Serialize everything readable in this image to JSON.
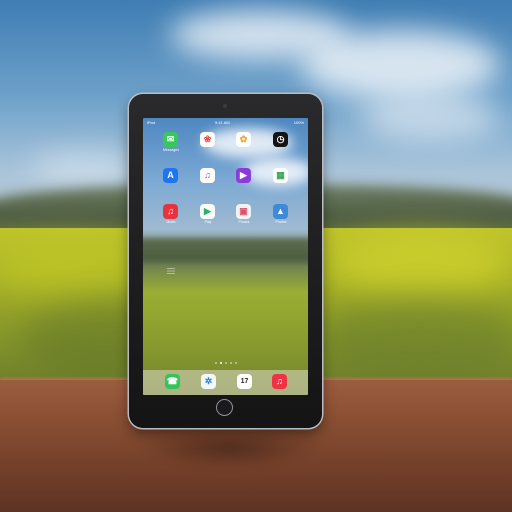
{
  "status_bar": {
    "carrier": "iPad",
    "time": "9:41 AM",
    "battery": "100%"
  },
  "home_apps": [
    {
      "name": "messages",
      "label": "Messages",
      "glyph": "✉"
    },
    {
      "name": "photos",
      "label": "",
      "glyph": "❀"
    },
    {
      "name": "photo-app",
      "label": "",
      "glyph": "✿"
    },
    {
      "name": "clock",
      "label": "",
      "glyph": "◷"
    },
    {
      "name": "app-store",
      "label": "",
      "glyph": "A"
    },
    {
      "name": "music",
      "label": "",
      "glyph": "♫"
    },
    {
      "name": "video",
      "label": "",
      "glyph": "▶"
    },
    {
      "name": "maps",
      "label": "",
      "glyph": "▦"
    },
    {
      "name": "itunes",
      "label": "Music",
      "glyph": "♫"
    },
    {
      "name": "play",
      "label": "Play",
      "glyph": "▶"
    },
    {
      "name": "grid-app",
      "label": "Photos",
      "glyph": "▣"
    },
    {
      "name": "blue-app",
      "label": "Photos",
      "glyph": "▲"
    }
  ],
  "dock_apps": [
    {
      "name": "phone",
      "glyph": "☎"
    },
    {
      "name": "safari",
      "glyph": "✲"
    },
    {
      "name": "calendar",
      "glyph": "17"
    },
    {
      "name": "itunes-dock",
      "glyph": "♫"
    }
  ],
  "colors": {
    "sky": "#6ea1ca",
    "field": "#a8b325",
    "table": "#8a4f33",
    "device_frame": "#1a1a1c"
  }
}
